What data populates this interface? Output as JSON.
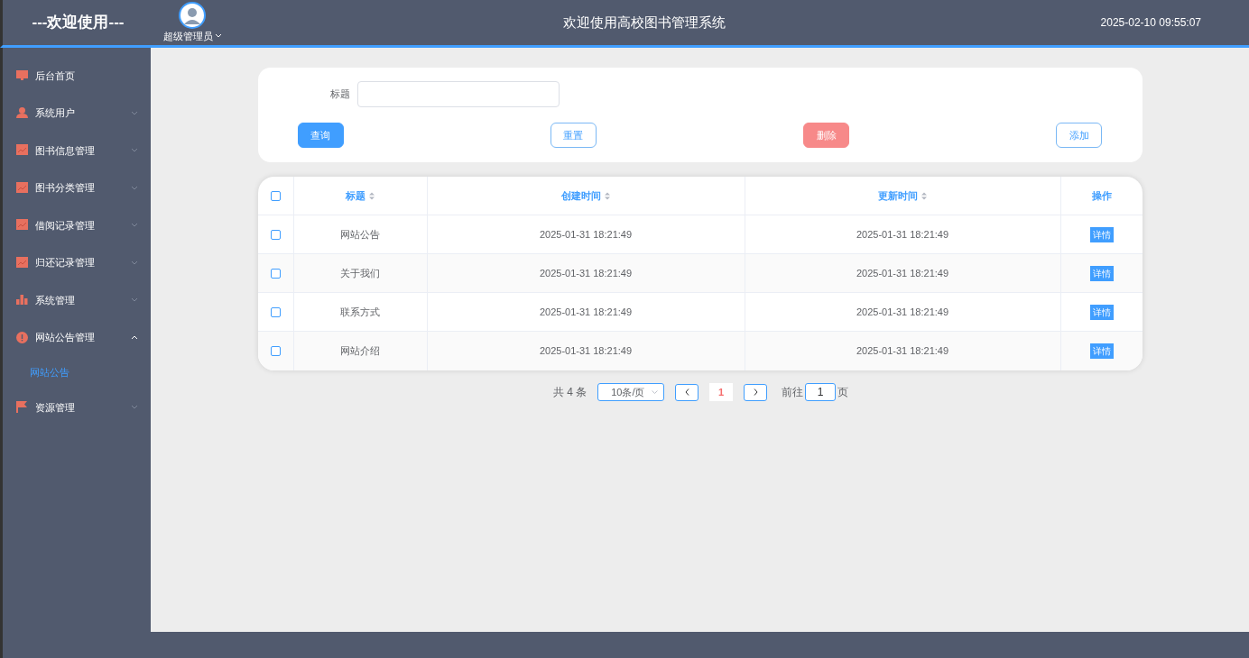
{
  "header": {
    "brand": "---欢迎使用---",
    "user": "超级管理员",
    "title": "欢迎使用高校图书管理系统",
    "datetime": "2025-02-10 09:55:07"
  },
  "sidebar": {
    "items": [
      {
        "label": "后台首页",
        "kind": "monitor"
      },
      {
        "label": "系统用户",
        "kind": "user",
        "expanded": false
      },
      {
        "label": "图书信息管理",
        "kind": "chart",
        "expanded": false
      },
      {
        "label": "图书分类管理",
        "kind": "chart",
        "expanded": false
      },
      {
        "label": "借阅记录管理",
        "kind": "chart",
        "expanded": false
      },
      {
        "label": "归还记录管理",
        "kind": "chart",
        "expanded": false
      },
      {
        "label": "系统管理",
        "kind": "bars",
        "expanded": false
      },
      {
        "label": "网站公告管理",
        "kind": "info",
        "expanded": true,
        "children": [
          {
            "label": "网站公告",
            "selected": true
          }
        ]
      },
      {
        "label": "资源管理",
        "kind": "flag",
        "expanded": false
      }
    ]
  },
  "search": {
    "label": "标题",
    "buttons": [
      {
        "label": "查询",
        "kind": "primary"
      },
      {
        "label": "重置",
        "kind": "outline"
      },
      {
        "label": "删除",
        "kind": "danger"
      },
      {
        "label": "添加",
        "kind": "outline"
      }
    ]
  },
  "table": {
    "all_checked": false,
    "columns": [
      "标题",
      "创建时间",
      "更新时间",
      "操作"
    ],
    "rows": [
      {
        "checked": false,
        "title": "网站公告",
        "created": "2025-01-31 18:21:49",
        "updated": "2025-01-31 18:21:49",
        "action": "详情"
      },
      {
        "checked": false,
        "title": "关于我们",
        "created": "2025-01-31 18:21:49",
        "updated": "2025-01-31 18:21:49",
        "action": "详情"
      },
      {
        "checked": false,
        "title": "联系方式",
        "created": "2025-01-31 18:21:49",
        "updated": "2025-01-31 18:21:49",
        "action": "详情"
      },
      {
        "checked": false,
        "title": "网站介绍",
        "created": "2025-01-31 18:21:49",
        "updated": "2025-01-31 18:21:49",
        "action": "详情"
      }
    ]
  },
  "pagination": {
    "total": "共 4 条",
    "page_size": "10条/页",
    "current_page": "1",
    "goto_label": "前往",
    "goto_value": "1",
    "page_suffix": "页"
  }
}
